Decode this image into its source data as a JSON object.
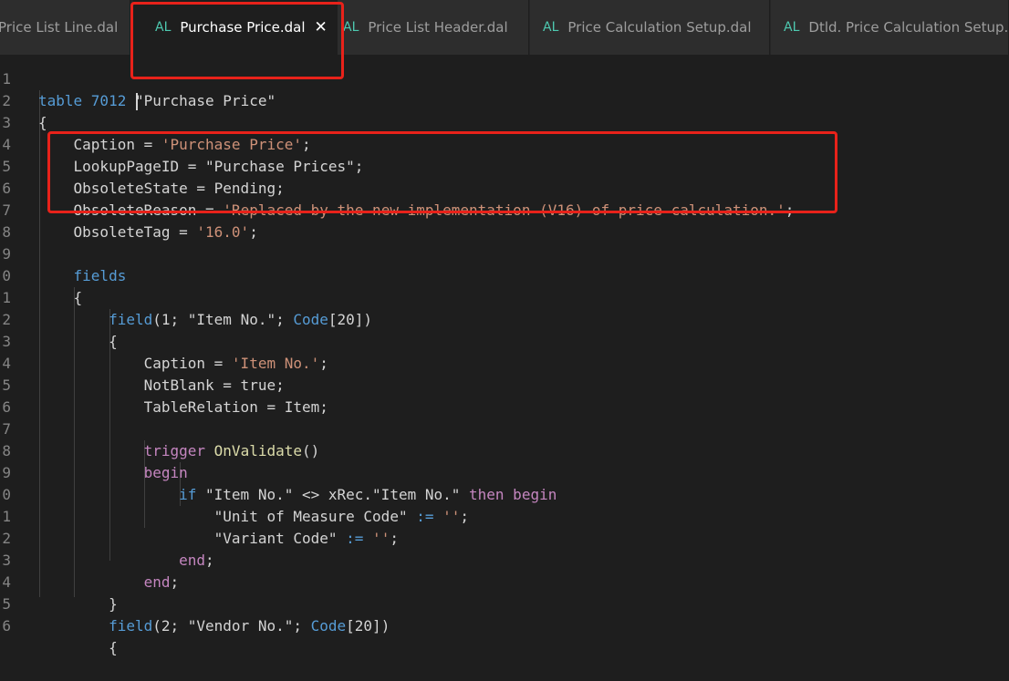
{
  "tabs": [
    {
      "label": "Price List Line.dal",
      "badge": "",
      "active": false
    },
    {
      "label": "Purchase Price.dal",
      "badge": "AL",
      "active": true,
      "close_glyph": "✕"
    },
    {
      "label": "Price List Header.dal",
      "badge": "AL",
      "active": false
    },
    {
      "label": "Price Calculation Setup.dal",
      "badge": "AL",
      "active": false
    },
    {
      "label": "Dtld. Price Calculation Setup.dal",
      "badge": "AL",
      "active": false
    }
  ],
  "line_numbers": [
    "1",
    "2",
    "3",
    "4",
    "5",
    "6",
    "7",
    "8",
    "9",
    "0",
    "1",
    "2",
    "3",
    "4",
    "5",
    "6",
    "7",
    "8",
    "9",
    "0",
    "1",
    "2",
    "3",
    "4",
    "5",
    "6"
  ],
  "code": {
    "l1": {
      "kw": "table 7012 ",
      "str": "\"Purchase Price\""
    },
    "l2": {
      "text": "{"
    },
    "l3": {
      "a": "    Caption = ",
      "s": "'Purchase Price'",
      "b": ";"
    },
    "l4": {
      "text": "    LookupPageID = \"Purchase Prices\";"
    },
    "l5": {
      "text": "    ObsoleteState = Pending;"
    },
    "l6": {
      "a": "    ObsoleteReason = ",
      "s": "'Replaced by the new implementation (V16) of price calculation.'",
      "b": ";"
    },
    "l7": {
      "a": "    ObsoleteTag = ",
      "s": "'16.0'",
      "b": ";"
    },
    "l8": {
      "text": ""
    },
    "l9": {
      "kw": "    fields"
    },
    "l10": {
      "text": "    {"
    },
    "l11": {
      "kw": "        field",
      "a": "(1; \"Item No.\"; ",
      "type": "Code",
      "b": "[20])"
    },
    "l12": {
      "text": "        {"
    },
    "l13": {
      "a": "            Caption = ",
      "s": "'Item No.'",
      "b": ";"
    },
    "l14": {
      "text": "            NotBlank = true;"
    },
    "l15": {
      "text": "            TableRelation = Item;"
    },
    "l16": {
      "text": ""
    },
    "l17": {
      "kw": "            trigger",
      "fn": " OnValidate",
      "b": "()"
    },
    "l18": {
      "kw": "            begin"
    },
    "l19": {
      "ctrl1": "                if",
      "a": " \"Item No.\" <> xRec.\"Item No.\" ",
      "ctrl2": "then begin"
    },
    "l20": {
      "a": "                    \"Unit of Measure Code\" ",
      "op": ":=",
      "s": " ''",
      "b": ";"
    },
    "l21": {
      "a": "                    \"Variant Code\" ",
      "op": ":=",
      "s": " ''",
      "b": ";"
    },
    "l22": {
      "ctrl1": "                end",
      "b": ";"
    },
    "l23": {
      "kw": "            end",
      "b": ";"
    },
    "l24": {
      "text": "        }"
    },
    "l25": {
      "kw": "        field",
      "a": "(2; \"Vendor No.\"; ",
      "type": "Code",
      "b": "[20])"
    },
    "l26": {
      "text": "        {"
    }
  },
  "colors": {
    "background": "#1e1e1e",
    "keyword": "#569cd6",
    "control": "#c586c0",
    "string": "#ce9178",
    "highlight_box": "#e8221a"
  }
}
